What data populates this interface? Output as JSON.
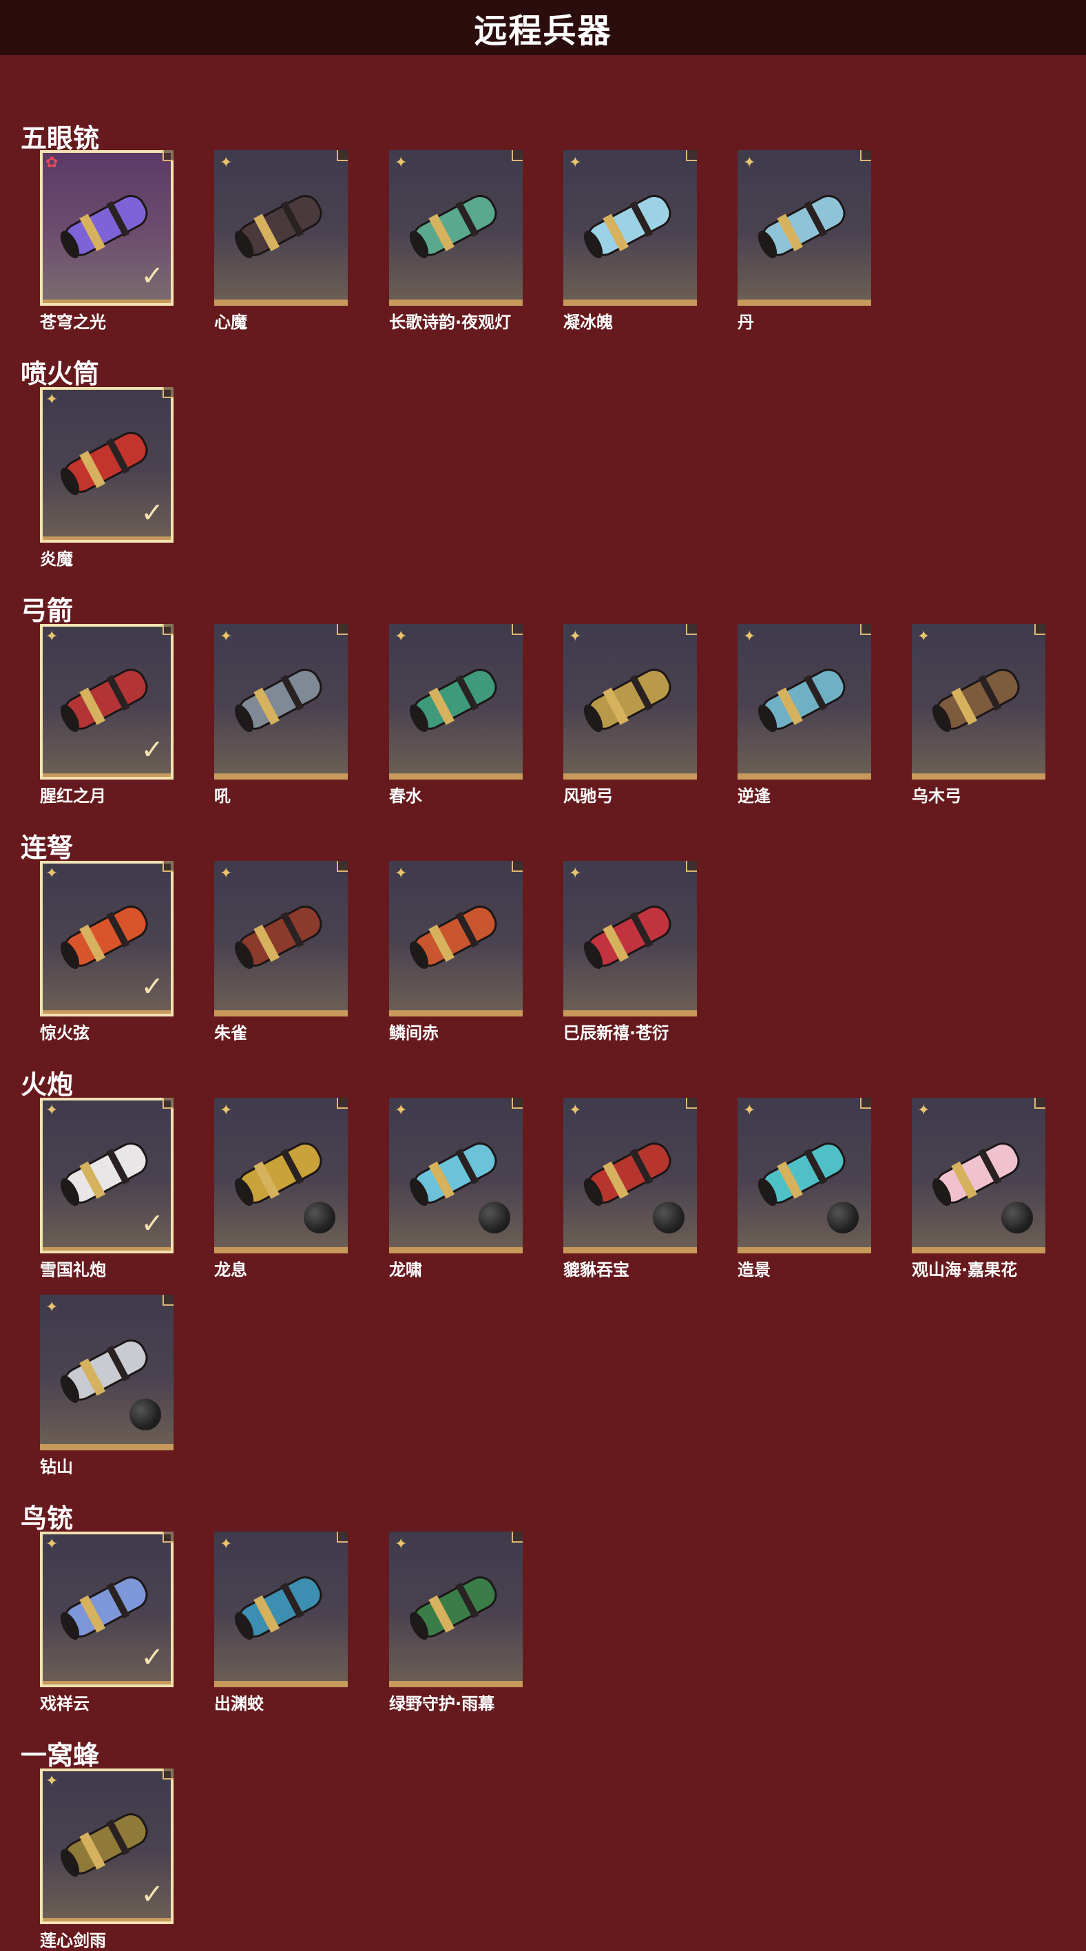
{
  "header": {
    "title": "远程兵器"
  },
  "sections": [
    {
      "title": "五眼铳",
      "items": [
        {
          "name": "苍穹之光",
          "selected": true,
          "rarity": "red",
          "color": "#7e63d8"
        },
        {
          "name": "心魔",
          "selected": false,
          "rarity": "gold",
          "color": "#4a3a3d"
        },
        {
          "name": "长歌诗韵·夜观灯",
          "selected": false,
          "rarity": "gold",
          "color": "#5aa88e"
        },
        {
          "name": "凝冰魄",
          "selected": false,
          "rarity": "gold",
          "color": "#9cd2e6"
        },
        {
          "name": "丹",
          "selected": false,
          "rarity": "gold",
          "color": "#8fc4d8"
        }
      ]
    },
    {
      "title": "喷火筒",
      "items": [
        {
          "name": "炎魔",
          "selected": true,
          "rarity": "gold",
          "color": "#c2342c"
        }
      ]
    },
    {
      "title": "弓箭",
      "items": [
        {
          "name": "腥红之月",
          "selected": true,
          "rarity": "gold",
          "color": "#b33434"
        },
        {
          "name": "吼",
          "selected": false,
          "rarity": "gold",
          "color": "#7f8a96"
        },
        {
          "name": "春水",
          "selected": false,
          "rarity": "gold",
          "color": "#3e9a7a"
        },
        {
          "name": "风驰弓",
          "selected": false,
          "rarity": "gold",
          "color": "#b89a4a"
        },
        {
          "name": "逆逢",
          "selected": false,
          "rarity": "gold",
          "color": "#6fb0c4"
        },
        {
          "name": "乌木弓",
          "selected": false,
          "rarity": "gold",
          "color": "#7d5b3d"
        }
      ]
    },
    {
      "title": "连弩",
      "items": [
        {
          "name": "惊火弦",
          "selected": true,
          "rarity": "gold",
          "color": "#d9542b"
        },
        {
          "name": "朱雀",
          "selected": false,
          "rarity": "gold",
          "color": "#8b3a2c"
        },
        {
          "name": "鳞间赤",
          "selected": false,
          "rarity": "gold",
          "color": "#c9562e"
        },
        {
          "name": "巳辰新禧·苍衍",
          "selected": false,
          "rarity": "gold",
          "color": "#c1333e"
        }
      ]
    },
    {
      "title": "火炮",
      "items": [
        {
          "name": "雪国礼炮",
          "selected": true,
          "rarity": "gold",
          "color": "#e8e6e6",
          "ball": false
        },
        {
          "name": "龙息",
          "selected": false,
          "rarity": "gold",
          "color": "#c9a23a",
          "ball": true
        },
        {
          "name": "龙啸",
          "selected": false,
          "rarity": "gold",
          "color": "#6cc2d8",
          "ball": true
        },
        {
          "name": "貔貅吞宝",
          "selected": false,
          "rarity": "gold",
          "color": "#b6362e",
          "ball": true
        },
        {
          "name": "造景",
          "selected": false,
          "rarity": "gold",
          "color": "#4fc1c6",
          "ball": true
        },
        {
          "name": "观山海·嘉果花",
          "selected": false,
          "rarity": "gold",
          "color": "#f0c2d0",
          "ball": true
        },
        {
          "name": "钻山",
          "selected": false,
          "rarity": "gold",
          "color": "#c9cbd2",
          "ball": true
        }
      ]
    },
    {
      "title": "鸟铳",
      "items": [
        {
          "name": "戏祥云",
          "selected": true,
          "rarity": "gold",
          "color": "#7d97d8"
        },
        {
          "name": "出渊蛟",
          "selected": false,
          "rarity": "gold",
          "color": "#3c8fb0"
        },
        {
          "name": "绿野守护·雨幕",
          "selected": false,
          "rarity": "gold",
          "color": "#3a7d49"
        }
      ]
    },
    {
      "title": "一窝蜂",
      "items": [
        {
          "name": "莲心剑雨",
          "selected": true,
          "rarity": "gold",
          "color": "#8f7a3a"
        }
      ]
    }
  ]
}
